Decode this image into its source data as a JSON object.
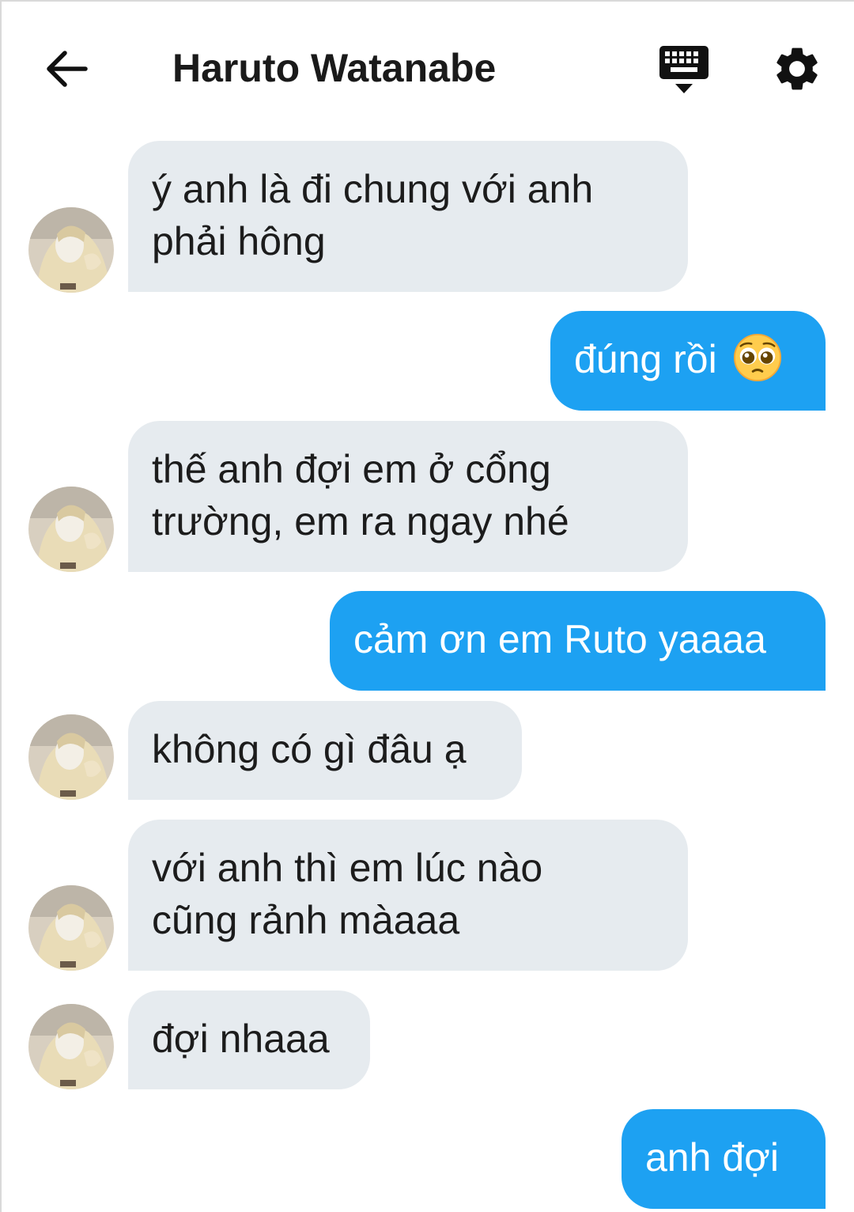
{
  "header": {
    "title": "Haruto Watanabe",
    "back_icon": "arrow-left-icon",
    "keyboard_icon": "keyboard-icon",
    "settings_icon": "gear-icon"
  },
  "colors": {
    "incoming_bubble": "#e6ebef",
    "outgoing_bubble": "#1da1f2",
    "text": "#1c1c1c"
  },
  "messages": [
    {
      "side": "in",
      "text_lines": [
        "ý anh là đi chung với anh",
        "phải hông"
      ]
    },
    {
      "side": "out",
      "text": "đúng rồi",
      "emoji": "pleading-face-emoji"
    },
    {
      "side": "in",
      "text_lines": [
        "thế anh đợi em ở cổng",
        "trường, em ra ngay nhé"
      ]
    },
    {
      "side": "out",
      "text": "cảm ơn em Ruto yaaaa"
    },
    {
      "side": "in",
      "text": "không có gì đâu ạ"
    },
    {
      "side": "in",
      "text_lines": [
        "với anh thì em lúc nào",
        "cũng rảnh màaaa"
      ]
    },
    {
      "side": "in",
      "text": "đợi nhaaa"
    },
    {
      "side": "out",
      "text": "anh đợi"
    }
  ]
}
